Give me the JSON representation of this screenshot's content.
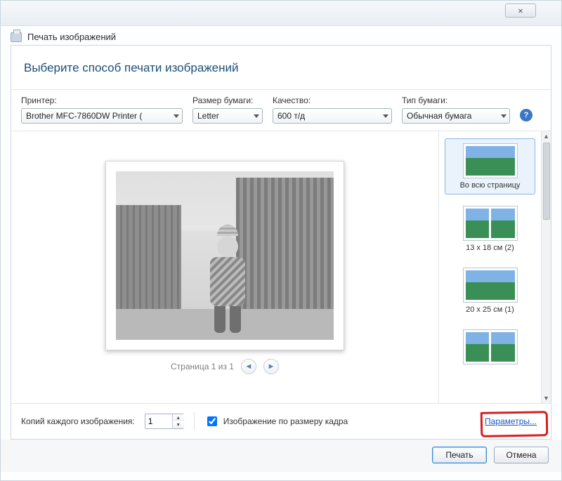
{
  "window_title": "Печать изображений",
  "heading": "Выберите способ печати изображений",
  "labels": {
    "printer": "Принтер:",
    "paper_size": "Размер бумаги:",
    "quality": "Качество:",
    "paper_type": "Тип бумаги:",
    "copies": "Копий каждого изображения:",
    "fit_frame": "Изображение по размеру кадра",
    "params": "Параметры...",
    "page_nav": "Страница 1 из 1"
  },
  "values": {
    "printer": "Brother MFC-7860DW Printer ( ",
    "paper_size": "Letter",
    "quality": "600 т/д",
    "paper_type": "Обычная бумага",
    "copies": "1",
    "fit_checked": true
  },
  "layouts": [
    {
      "label": "Во всю страницу",
      "panels": 1,
      "selected": true
    },
    {
      "label": "13 x 18 см (2)",
      "panels": 2,
      "selected": false
    },
    {
      "label": "20 x 25 см (1)",
      "panels": 1,
      "selected": false
    },
    {
      "label": "",
      "panels": 2,
      "selected": false
    }
  ],
  "buttons": {
    "print": "Печать",
    "cancel": "Отмена"
  },
  "icons": {
    "help": "?",
    "prev": "◄",
    "next": "►",
    "up": "▲",
    "down": "▼",
    "close": "✕"
  }
}
